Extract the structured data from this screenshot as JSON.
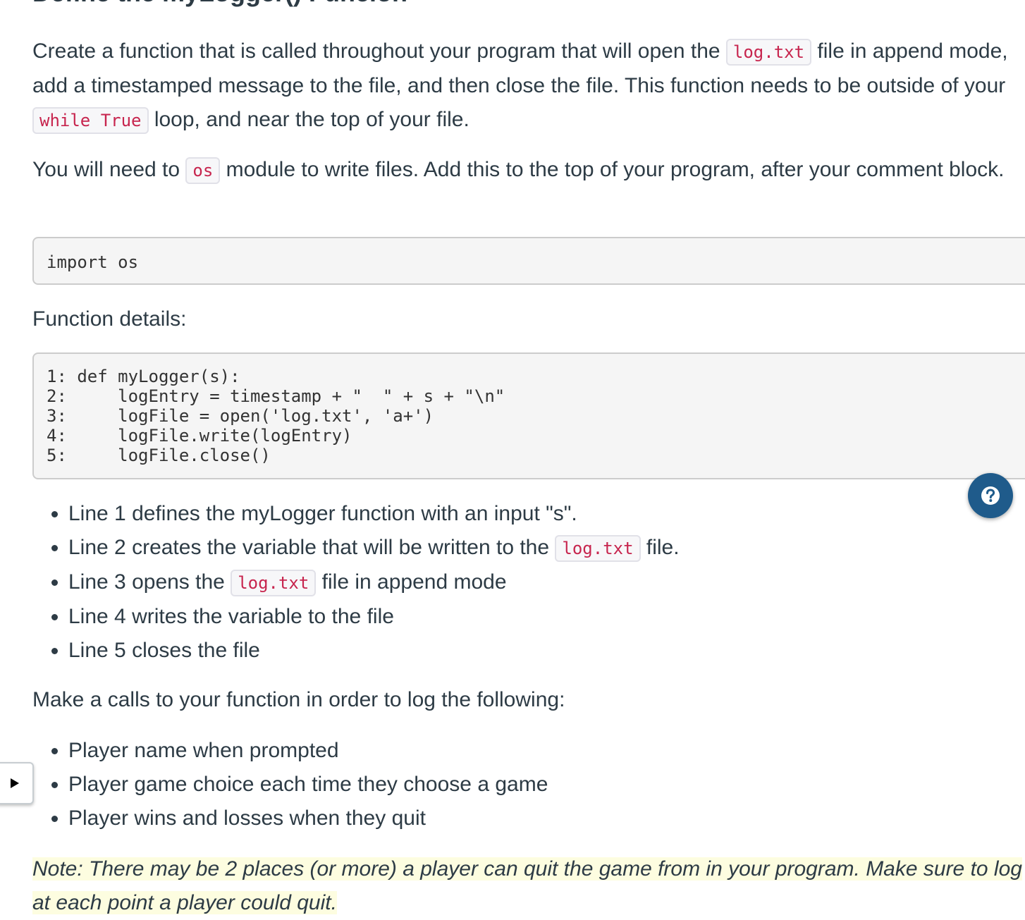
{
  "heading": "Define the myLogger() Funcion",
  "intro": {
    "part1": "Create a function that is called throughout your program that will open the ",
    "code1": "log.txt",
    "part2": " file in append mode, add a timestamped message to the file, and then close the file. This function needs to be outside of your ",
    "code2": "while True",
    "part3": " loop, and near the top of your file."
  },
  "module_para": {
    "part1": "You will need to ",
    "code": "os",
    "part2": " module to write files. Add this to the top of your program, after your comment block."
  },
  "import_code": "import os",
  "function_details_label": "Function details:",
  "function_code": [
    "1: def myLogger(s):",
    "2:     logEntry = timestamp + \"  \" + s + \"\\n\"",
    "3:     logFile = open('log.txt', 'a+')",
    "4:     logFile.write(logEntry)",
    "5:     logFile.close()"
  ],
  "line_details": {
    "item1": "Line 1 defines the myLogger function with an input \"s\".",
    "item2_part1": "Line 2 creates the variable that will be written to the ",
    "item2_code": "log.txt",
    "item2_part2": " file.",
    "item3_part1": "Line 3 opens the ",
    "item3_code": "log.txt",
    "item3_part2": " file in append mode",
    "item4": "Line 4 writes the variable to the file",
    "item5": "Line 5 closes the file"
  },
  "calls_label": "Make a calls to your function in order to log the following:",
  "calls_list": [
    "Player name when prompted",
    "Player game choice each time they choose a game",
    "Player wins and losses when they quit"
  ],
  "note": "Note: There may be 2 places (or more) a player can quit the game from in your program. Make sure to log at each point a player could quit.",
  "help_button": {
    "icon": "question-icon",
    "color": "#1f5b8b"
  },
  "expand_tab": {
    "icon": "play-triangle-icon"
  }
}
